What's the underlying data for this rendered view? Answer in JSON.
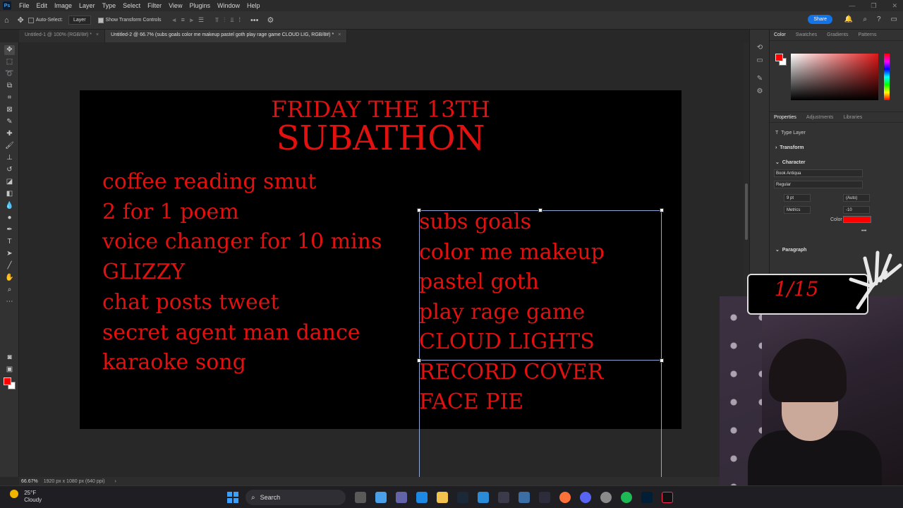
{
  "app": {
    "logo": "Ps",
    "menu": [
      "File",
      "Edit",
      "Image",
      "Layer",
      "Type",
      "Select",
      "Filter",
      "View",
      "Plugins",
      "Window",
      "Help"
    ]
  },
  "options": {
    "auto_select_label": "Auto-Select:",
    "layer_select": "Layer",
    "transform_label": "Show Transform Controls",
    "more": "•••",
    "share": "Share"
  },
  "tabs": [
    {
      "label": "Untitled-1 @ 100% (RGB/8#) *",
      "active": false
    },
    {
      "label": "Untitled-2 @ 66.7% (subs goals color me makeup pastel goth play rage game CLOUD LIG, RGB/8#) *",
      "active": true
    }
  ],
  "canvas": {
    "title_line1": "FRIDAY THE 13TH",
    "title_line2": "SUBATHON",
    "left_list": [
      "coffee reading smut",
      "2 for 1 poem",
      "voice changer for 10 mins",
      "GLIZZY",
      "chat posts tweet",
      "secret agent man dance",
      "karaoke song"
    ],
    "right_list": [
      "subs goals",
      "color me makeup",
      "pastel goth",
      "play rage game",
      "CLOUD LIGHTS",
      "RECORD COVER",
      "FACE PIE"
    ],
    "text_color": "#e31010"
  },
  "status": {
    "zoom": "66.67%",
    "doc_info": "1920 px x 1080 px (640 ppi)",
    "arrow": "›"
  },
  "panels": {
    "color_tabs": [
      "Color",
      "Swatches",
      "Gradients",
      "Patterns"
    ],
    "properties_tabs": [
      "Properties",
      "Adjustments",
      "Libraries"
    ],
    "type_layer": "Type Layer",
    "transform": "Transform",
    "character": "Character",
    "font_family": "Book Antiqua",
    "font_style": "Regular",
    "font_size": "9 pt",
    "leading": "(Auto)",
    "kerning": "Metrics",
    "tracking": "-10",
    "color_label": "Color",
    "paragraph": "Paragraph",
    "ellipsis": "•••",
    "foreground": "#ff0000",
    "background": "#ffffff"
  },
  "overlay": {
    "counter": "1/15"
  },
  "taskbar": {
    "temperature": "25°F",
    "condition": "Cloudy",
    "search": "Search"
  }
}
